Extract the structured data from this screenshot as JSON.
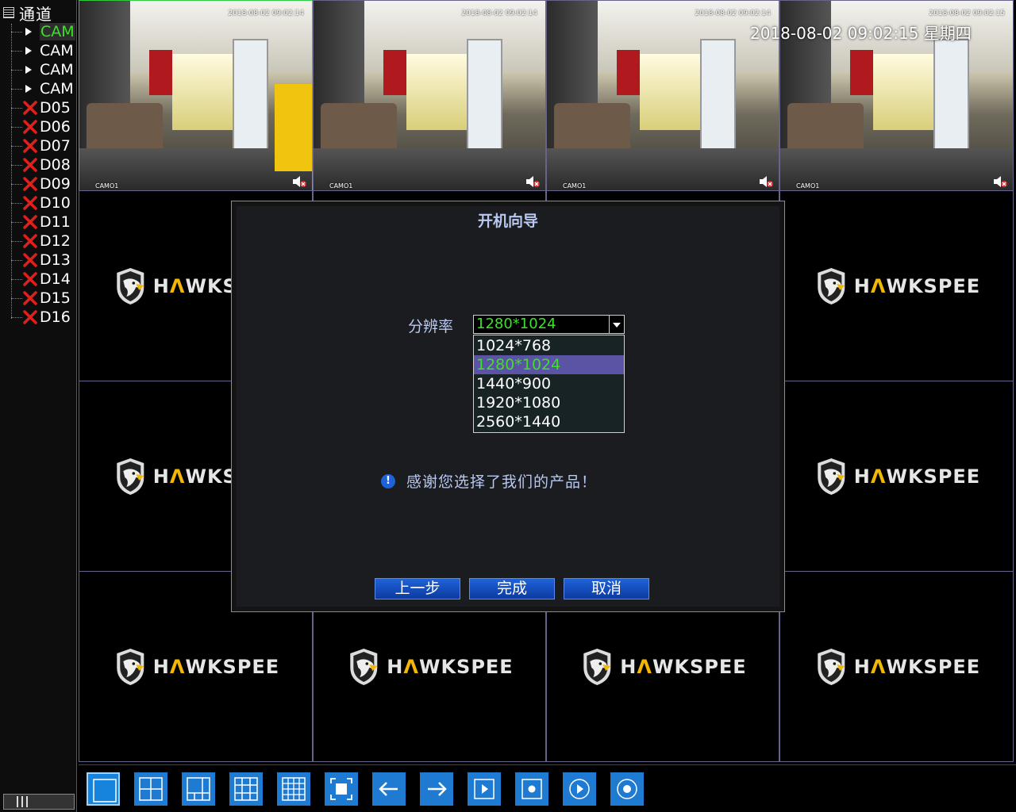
{
  "sidebar": {
    "title": "通道",
    "channels": [
      {
        "label": "CAM",
        "status": "online",
        "selected": true
      },
      {
        "label": "CAM",
        "status": "online",
        "selected": false
      },
      {
        "label": "CAM",
        "status": "online",
        "selected": false
      },
      {
        "label": "CAM",
        "status": "online",
        "selected": false
      },
      {
        "label": "D05",
        "status": "offline"
      },
      {
        "label": "D06",
        "status": "offline"
      },
      {
        "label": "D07",
        "status": "offline"
      },
      {
        "label": "D08",
        "status": "offline"
      },
      {
        "label": "D09",
        "status": "offline"
      },
      {
        "label": "D10",
        "status": "offline"
      },
      {
        "label": "D11",
        "status": "offline"
      },
      {
        "label": "D12",
        "status": "offline"
      },
      {
        "label": "D13",
        "status": "offline"
      },
      {
        "label": "D14",
        "status": "offline"
      },
      {
        "label": "D15",
        "status": "offline"
      },
      {
        "label": "D16",
        "status": "offline"
      }
    ]
  },
  "overlay_datetime": "2018-08-02 09:02:15 星期四",
  "cameras": [
    {
      "timestamp": "2018-08-02 09:02:14",
      "name": "CAMO1"
    },
    {
      "timestamp": "2018-08-02 09:02:14",
      "name": "CAMO1"
    },
    {
      "timestamp": "2018-08-02 09:02:14",
      "name": "CAMO1"
    },
    {
      "timestamp": "2018-08-02 09:02:15",
      "name": "CAMO1"
    }
  ],
  "logo": {
    "text_a": "H",
    "text_mark": "Λ",
    "text_b": "WKSPEE"
  },
  "dialog": {
    "title": "开机向导",
    "resolution_label": "分辨率",
    "resolution_value": "1280*1024",
    "resolution_options": [
      "1024*768",
      "1280*1024",
      "1440*900",
      "1920*1080",
      "2560*1440"
    ],
    "selected_option": "1280*1024",
    "thanks": "感谢您选择了我们的产品！",
    "info_icon": "!",
    "buttons": {
      "prev": "上一步",
      "finish": "完成",
      "cancel": "取消"
    }
  },
  "toolbar": {
    "buttons": [
      "layout-1-icon",
      "layout-4-icon",
      "layout-6-icon",
      "layout-9-icon",
      "layout-16-icon",
      "fullscreen-icon",
      "prev-page-icon",
      "next-page-icon",
      "play-icon",
      "record-icon",
      "playback-icon",
      "snapshot-icon"
    ]
  },
  "colors": {
    "accent_green": "#3fe02a",
    "button_blue": "#1f7ad2",
    "selected_option_bg": "#5b53a3",
    "grid_border": "#66648a"
  }
}
